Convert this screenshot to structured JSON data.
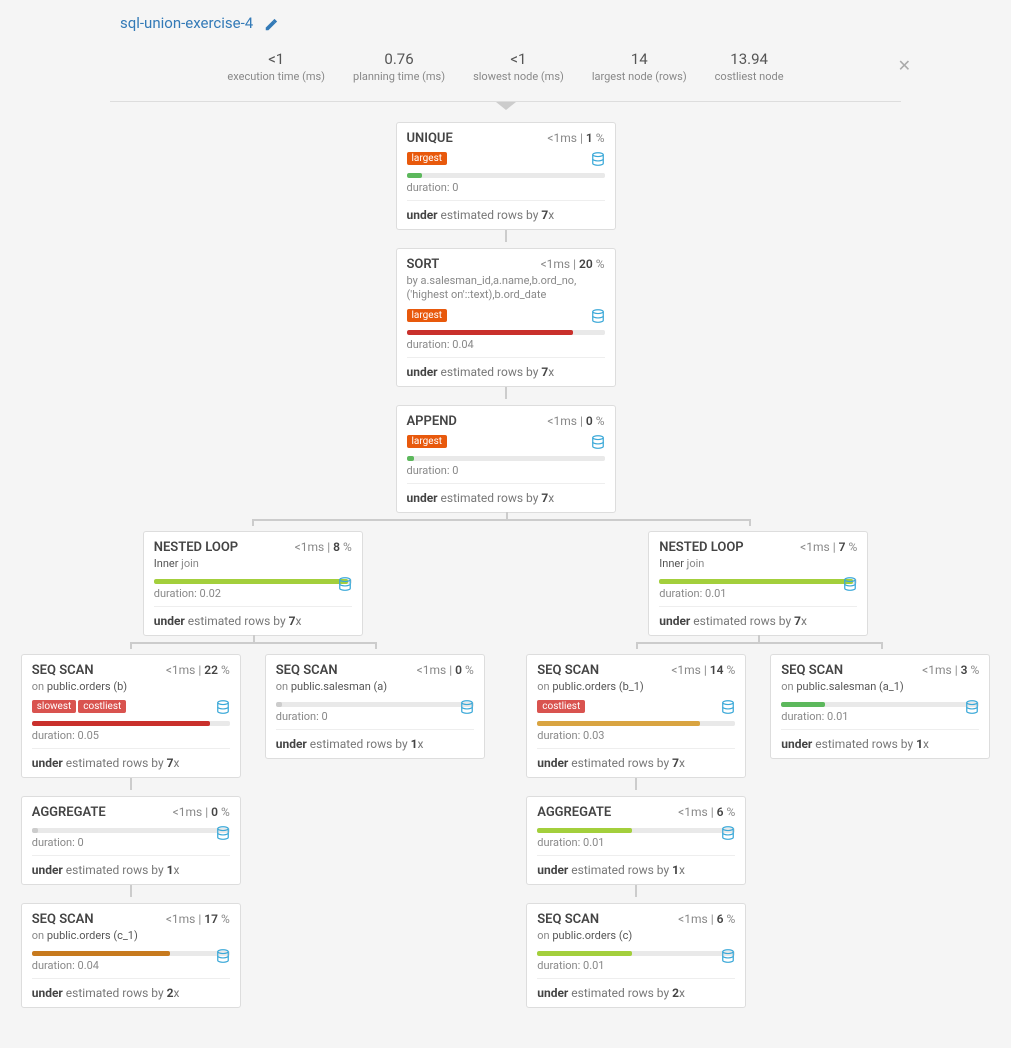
{
  "title": "sql-union-exercise-4",
  "stats": [
    {
      "value": "<1",
      "label": "execution time (ms)"
    },
    {
      "value": "0.76",
      "label": "planning time (ms)"
    },
    {
      "value": "<1",
      "label": "slowest node (ms)"
    },
    {
      "value": "14",
      "label": "largest node (rows)"
    },
    {
      "value": "13.94",
      "label": "costliest node"
    }
  ],
  "nodes": {
    "unique": {
      "title": "UNIQUE",
      "time": "<1ms",
      "pct": "1",
      "badges": [
        "largest"
      ],
      "bar_pct": 8,
      "bar_color": "#5cb85c",
      "duration": "0",
      "est_mult": "7"
    },
    "sort": {
      "title": "SORT",
      "time": "<1ms",
      "pct": "20",
      "subtitle": "by a.salesman_id,a.name,b.ord_no,('highest on'::text),b.ord_date",
      "badges": [
        "largest"
      ],
      "bar_pct": 84,
      "bar_color": "#c9302c",
      "duration": "0.04",
      "est_mult": "7"
    },
    "append": {
      "title": "APPEND",
      "time": "<1ms",
      "pct": "0",
      "badges": [
        "largest"
      ],
      "bar_pct": 4,
      "bar_color": "#5cb85c",
      "duration": "0",
      "est_mult": "7"
    },
    "nloop1": {
      "title": "NESTED LOOP",
      "time": "<1ms",
      "pct": "8",
      "subtitle_prefix": "Inner",
      "subtitle_suffix": " join",
      "bar_pct": 98,
      "bar_color": "#a3cf3c",
      "duration": "0.02",
      "est_mult": "7"
    },
    "nloop2": {
      "title": "NESTED LOOP",
      "time": "<1ms",
      "pct": "7",
      "subtitle_prefix": "Inner",
      "subtitle_suffix": " join",
      "bar_pct": 98,
      "bar_color": "#a3cf3c",
      "duration": "0.01",
      "est_mult": "7"
    },
    "seq_b": {
      "title": "SEQ SCAN",
      "time": "<1ms",
      "pct": "22",
      "on_prefix": "on ",
      "on": "public.orders (b)",
      "badges": [
        "slowest",
        "costliest"
      ],
      "bar_pct": 90,
      "bar_color": "#c9302c",
      "duration": "0.05",
      "est_mult": "7"
    },
    "seq_a": {
      "title": "SEQ SCAN",
      "time": "<1ms",
      "pct": "0",
      "on_prefix": "on ",
      "on": "public.salesman (a)",
      "bar_pct": 3,
      "bar_color": "#ccc",
      "duration": "0",
      "est_mult": "1"
    },
    "seq_b1": {
      "title": "SEQ SCAN",
      "time": "<1ms",
      "pct": "14",
      "on_prefix": "on ",
      "on": "public.orders (b_1)",
      "badges": [
        "costliest"
      ],
      "bar_pct": 82,
      "bar_color": "#d9a441",
      "duration": "0.03",
      "est_mult": "7"
    },
    "seq_a1": {
      "title": "SEQ SCAN",
      "time": "<1ms",
      "pct": "3",
      "on_prefix": "on ",
      "on": "public.salesman (a_1)",
      "bar_pct": 22,
      "bar_color": "#5cb85c",
      "duration": "0.01",
      "est_mult": "1"
    },
    "agg1": {
      "title": "AGGREGATE",
      "time": "<1ms",
      "pct": "0",
      "bar_pct": 3,
      "bar_color": "#ccc",
      "duration": "0",
      "est_mult": "1"
    },
    "agg2": {
      "title": "AGGREGATE",
      "time": "<1ms",
      "pct": "6",
      "bar_pct": 48,
      "bar_color": "#a3cf3c",
      "duration": "0.01",
      "est_mult": "1"
    },
    "seq_c1": {
      "title": "SEQ SCAN",
      "time": "<1ms",
      "pct": "17",
      "on_prefix": "on ",
      "on": "public.orders (c_1)",
      "bar_pct": 70,
      "bar_color": "#c77a1e",
      "duration": "0.04",
      "est_mult": "2"
    },
    "seq_c": {
      "title": "SEQ SCAN",
      "time": "<1ms",
      "pct": "6",
      "on_prefix": "on ",
      "on": "public.orders (c)",
      "bar_pct": 48,
      "bar_color": "#a3cf3c",
      "duration": "0.01",
      "est_mult": "2"
    }
  },
  "labels": {
    "duration_prefix": "duration: ",
    "under": "under",
    "est_mid": " estimated rows by ",
    "est_suffix": "x"
  }
}
